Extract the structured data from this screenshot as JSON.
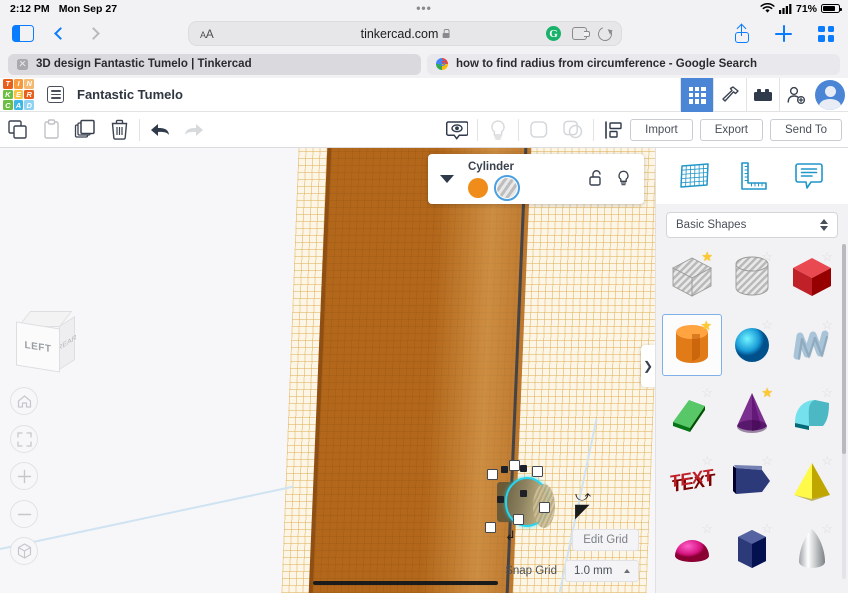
{
  "status_bar": {
    "time": "2:12 PM",
    "date": "Mon Sep 27",
    "dots": "•••",
    "battery_percent": "71%",
    "wifi_icon": "wifi-icon",
    "signal_icon": "cellular-signal-icon",
    "battery_icon": "battery-icon",
    "battery_level": 71
  },
  "browser": {
    "sidebar_toggle_icon": "sidebar-toggle-icon",
    "back_icon": "chevron-left-icon",
    "forward_icon": "chevron-right-icon",
    "url_bar": {
      "aa_label": "AA",
      "url": "tinkercad.com",
      "lock_icon": "lock-icon",
      "grammarly_icon": "grammarly-icon",
      "grammarly_letter": "G",
      "extension_icon": "puzzle-extension-icon",
      "reload_icon": "reload-icon"
    },
    "share_icon": "share-icon",
    "new_tab_icon": "plus-icon",
    "show_tabs_icon": "tab-overview-icon",
    "tabs": [
      {
        "title": "3D design Fantastic Tumelo | Tinkercad",
        "active": true,
        "favicon": "close-icon"
      },
      {
        "title": "how to find radius from circumference - Google Search",
        "active": false,
        "favicon": "google-icon"
      }
    ]
  },
  "app_header": {
    "logo": {
      "name": "tinkercad-logo",
      "tiles": [
        {
          "letter": "T",
          "color": "#e8601c"
        },
        {
          "letter": "I",
          "color": "#f79a3e"
        },
        {
          "letter": "N",
          "color": "#f5b971"
        },
        {
          "letter": "K",
          "color": "#6cbe45"
        },
        {
          "letter": "E",
          "color": "#f6c344"
        },
        {
          "letter": "R",
          "color": "#e8601c"
        },
        {
          "letter": "C",
          "color": "#6cbe45"
        },
        {
          "letter": "A",
          "color": "#3fb7e4"
        },
        {
          "letter": "D",
          "color": "#8fd3f0"
        }
      ]
    },
    "document_icon": "document-list-icon",
    "project_title": "Fantastic Tumelo",
    "right_buttons": [
      {
        "name": "grid-view-button",
        "icon": "grid-icon",
        "active": true
      },
      {
        "name": "tools-button",
        "icon": "hammer-icon",
        "active": false
      },
      {
        "name": "blocks-button",
        "icon": "blocks-icon",
        "active": false
      },
      {
        "name": "invite-button",
        "icon": "add-person-icon",
        "active": false
      }
    ],
    "avatar": "user-avatar"
  },
  "toolbar": {
    "left_tools": [
      {
        "name": "copy-button",
        "icon": "copy-icon",
        "disabled": false
      },
      {
        "name": "paste-button",
        "icon": "paste-icon",
        "disabled": true
      },
      {
        "name": "duplicate-button",
        "icon": "duplicate-icon",
        "disabled": false
      },
      {
        "name": "delete-button",
        "icon": "trash-icon",
        "disabled": false
      },
      {
        "name": "undo-button",
        "icon": "undo-arrow-icon",
        "disabled": false
      },
      {
        "name": "redo-button",
        "icon": "redo-arrow-icon",
        "disabled": true
      }
    ],
    "center_tools": [
      {
        "name": "show-hide-button",
        "icon": "eye-icon",
        "disabled": false
      },
      {
        "name": "light-button",
        "icon": "lightbulb-icon",
        "disabled": true
      },
      {
        "name": "group-button",
        "icon": "group-icon",
        "disabled": true
      },
      {
        "name": "ungroup-button",
        "icon": "ungroup-icon",
        "disabled": true
      },
      {
        "name": "align-button",
        "icon": "align-icon",
        "disabled": false
      },
      {
        "name": "mirror-button",
        "icon": "mirror-icon",
        "disabled": false
      }
    ],
    "import_label": "Import",
    "export_label": "Export",
    "send_to_label": "Send To"
  },
  "view_controls": {
    "viewcube_face": "LEFT",
    "viewcube_side": "REAR",
    "buttons": [
      {
        "name": "home-view-button",
        "icon": "home-icon"
      },
      {
        "name": "fit-to-view-button",
        "icon": "fit-frame-icon"
      },
      {
        "name": "zoom-in-button",
        "icon": "plus-icon"
      },
      {
        "name": "zoom-out-button",
        "icon": "minus-icon"
      },
      {
        "name": "perspective-toggle-button",
        "icon": "ortho-cube-icon"
      }
    ]
  },
  "object_panel": {
    "collapse_icon": "triangle-down-icon",
    "title": "Cylinder",
    "solid_swatch": {
      "name": "solid-color-swatch",
      "color": "#f08c1a",
      "selected": false
    },
    "hole_swatch": {
      "name": "hole-swatch",
      "color": "#c8c8c8",
      "selected": true
    },
    "lock_icon": "unlocked-padlock-icon",
    "light_icon": "lightbulb-icon"
  },
  "canvas": {
    "edit_grid_label": "Edit Grid",
    "snap_grid_label": "Snap Grid",
    "snap_grid_value": "1.0 mm",
    "snap_caret_icon": "caret-up-icon",
    "selected_object": "cylinder-hole",
    "selection_color": "#23d7f2"
  },
  "right_panel": {
    "tabs": [
      {
        "name": "workplane-tab",
        "icon": "workplane-grid-icon"
      },
      {
        "name": "ruler-tab",
        "icon": "ruler-icon"
      },
      {
        "name": "notes-tab",
        "icon": "note-comment-icon"
      }
    ],
    "category_label": "Basic Shapes",
    "category_stepper_icon": "stepper-icon",
    "shapes": [
      {
        "name": "shape-box-hole",
        "label": "Box Hole",
        "starred": true,
        "selected": false,
        "color": "#c9c9c9"
      },
      {
        "name": "shape-cylinder-hole",
        "label": "Cylinder Hole",
        "starred": false,
        "selected": false,
        "color": "#c9c9c9"
      },
      {
        "name": "shape-box",
        "label": "Box",
        "starred": false,
        "selected": false,
        "color": "#c02028"
      },
      {
        "name": "shape-cylinder",
        "label": "Cylinder",
        "starred": true,
        "selected": true,
        "color": "#e07b18"
      },
      {
        "name": "shape-sphere",
        "label": "Sphere",
        "starred": false,
        "selected": false,
        "color": "#1a9cd8"
      },
      {
        "name": "shape-scribble",
        "label": "Scribble",
        "starred": false,
        "selected": false,
        "color": "#a9c4d8"
      },
      {
        "name": "shape-roof",
        "label": "Roof",
        "starred": false,
        "selected": false,
        "color": "#2e9e3e"
      },
      {
        "name": "shape-cone",
        "label": "Cone",
        "starred": true,
        "selected": false,
        "color": "#7b2f8e"
      },
      {
        "name": "shape-round-roof",
        "label": "Round Roof",
        "starred": false,
        "selected": false,
        "color": "#4bb8c4"
      },
      {
        "name": "shape-text",
        "label": "Text",
        "starred": false,
        "selected": false,
        "color": "#c02028",
        "text": "TEXT"
      },
      {
        "name": "shape-pentagon",
        "label": "Pentagon Prism",
        "starred": false,
        "selected": false,
        "color": "#2c3a7a"
      },
      {
        "name": "shape-pyramid",
        "label": "Pyramid",
        "starred": false,
        "selected": false,
        "color": "#e8d020"
      },
      {
        "name": "shape-half-sphere",
        "label": "Half Sphere",
        "starred": false,
        "selected": false,
        "color": "#d6147f"
      },
      {
        "name": "shape-hex-prism",
        "label": "Hexagonal Prism",
        "starred": false,
        "selected": false,
        "color": "#2c3a7a"
      },
      {
        "name": "shape-paraboloid",
        "label": "Paraboloid",
        "starred": false,
        "selected": false,
        "color": "#c8cdd0"
      }
    ]
  }
}
